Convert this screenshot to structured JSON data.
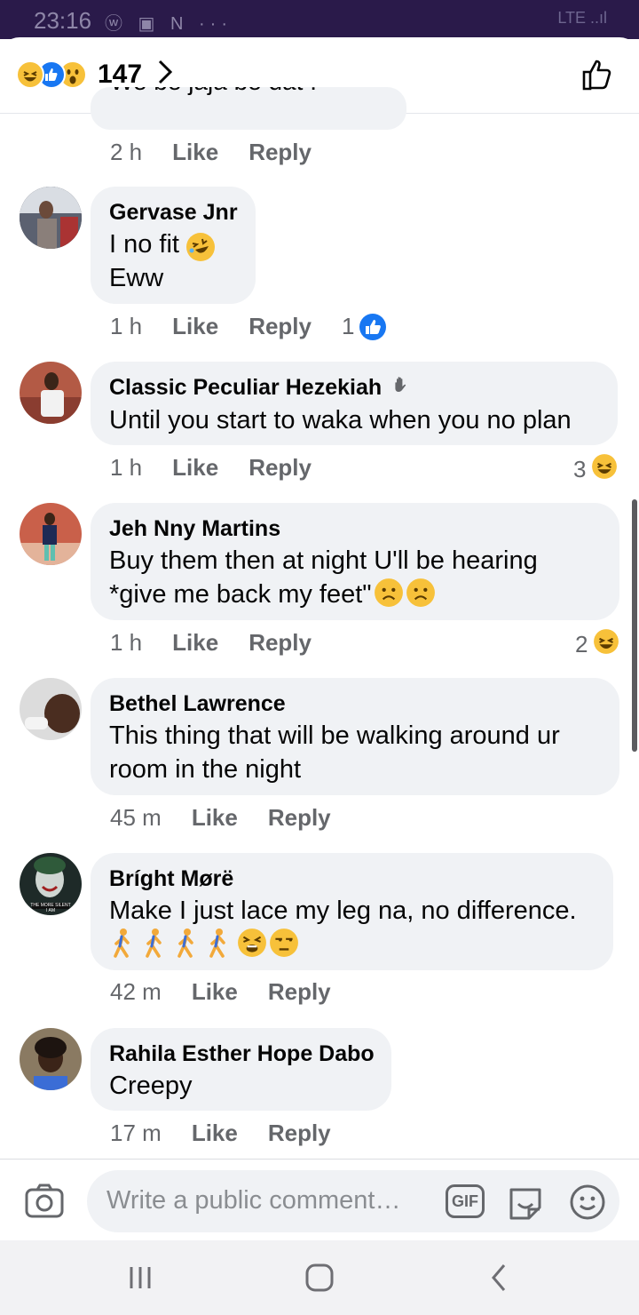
{
  "status_bar": {
    "time": "23:16",
    "icons": "ⓦ ▣ N ···",
    "right": "LTE ..ıl"
  },
  "header": {
    "reaction_count": "147",
    "reactions": [
      "haha",
      "like",
      "wow"
    ]
  },
  "partial_comment": {
    "text": "We be jaja be dat !"
  },
  "partial_meta": {
    "time": "2 h",
    "like": "Like",
    "reply": "Reply"
  },
  "comments": [
    {
      "name": "Gervase Jnr",
      "text": "I no fit\nEww",
      "time": "1 h",
      "like": "Like",
      "reply": "Reply",
      "reaction_count": "1",
      "reaction": "like"
    },
    {
      "name": "Classic Peculiar Hezekiah",
      "text": "Until you start to waka when you no plan",
      "time": "1 h",
      "like": "Like",
      "reply": "Reply",
      "reaction_count": "3",
      "reaction": "haha"
    },
    {
      "name": "Jeh Nny Martins",
      "text": "Buy them then at night U'll be hearing\n*give me back my feet\"",
      "time": "1 h",
      "like": "Like",
      "reply": "Reply",
      "reaction_count": "2",
      "reaction": "haha"
    },
    {
      "name": "Bethel Lawrence",
      "text": "This thing that will be walking around ur\nroom in the night",
      "time": "45 m",
      "like": "Like",
      "reply": "Reply"
    },
    {
      "name": "Bríght Mørë",
      "text": "Make I just lace my leg na, no difference.",
      "time": "42 m",
      "like": "Like",
      "reply": "Reply",
      "avatar_caption": "THE MORE SILENT I AM"
    },
    {
      "name": "Rahila Esther Hope Dabo",
      "text": "Creepy",
      "time": "17 m",
      "like": "Like",
      "reply": "Reply"
    }
  ],
  "composer": {
    "placeholder": "Write a public comment…",
    "gif_label": "GIF"
  },
  "colors": {
    "status_bar": "#2a1a4a",
    "bubble": "#f0f2f5",
    "secondary_text": "#65676b",
    "like_blue": "#1877f2",
    "emoji_yellow": "#f7c13a"
  },
  "icons": [
    "thumbs-up-icon",
    "camera-icon",
    "gif-icon",
    "sticker-icon",
    "smiley-icon",
    "recents-icon",
    "home-icon",
    "back-icon",
    "wave-icon"
  ]
}
